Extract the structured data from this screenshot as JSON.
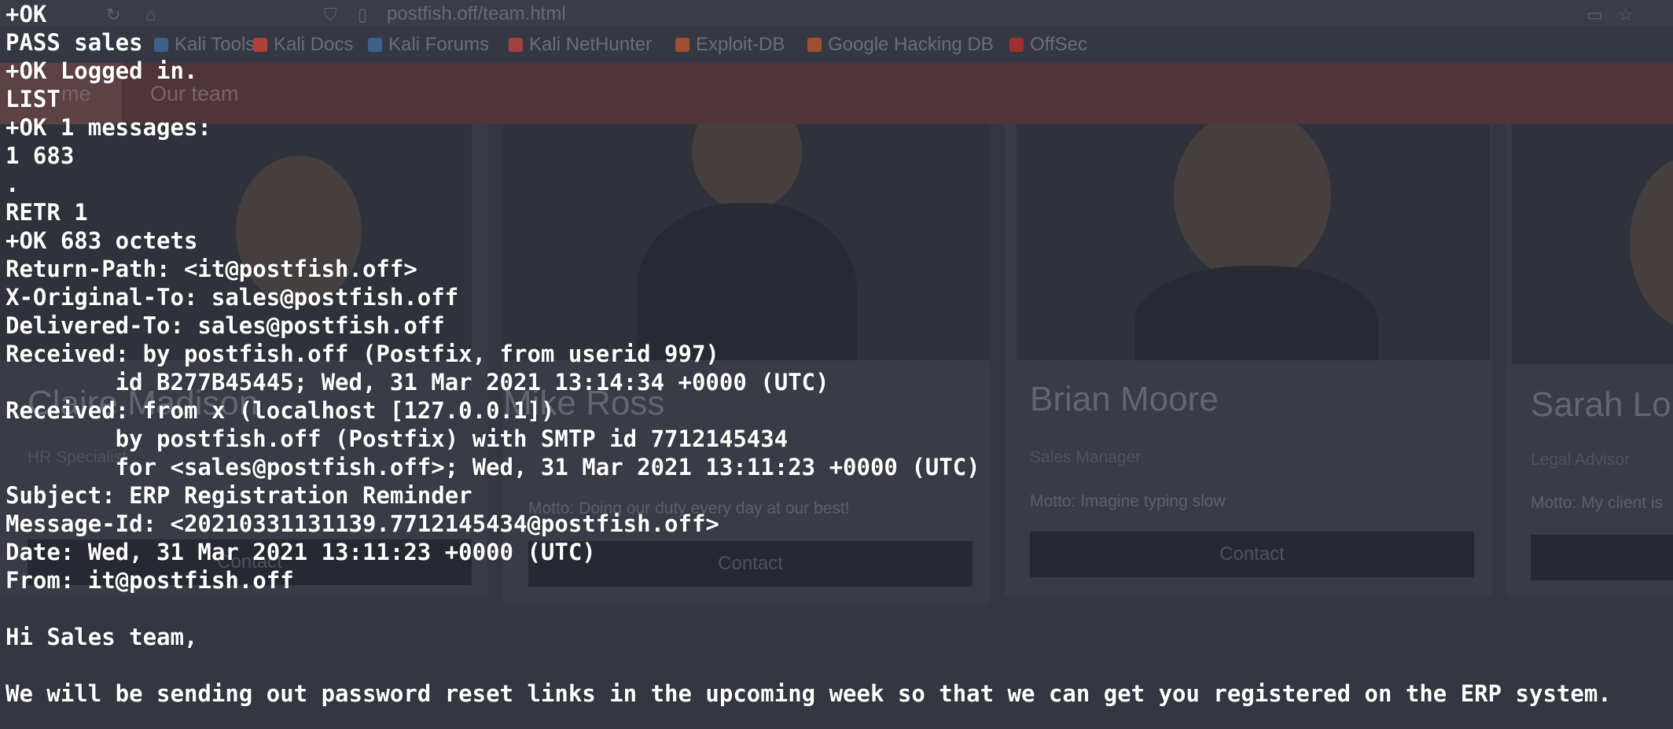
{
  "browser": {
    "url": "postfish.off/team.html",
    "bookmarks": [
      {
        "label": "Kali Tools",
        "color": "#3e5f8a"
      },
      {
        "label": "Kali Docs",
        "color": "#b0403a"
      },
      {
        "label": "Kali Forums",
        "color": "#3e5f8a"
      },
      {
        "label": "Kali NetHunter",
        "color": "#a04040"
      },
      {
        "label": "Exploit-DB",
        "color": "#a05030"
      },
      {
        "label": "Google Hacking DB",
        "color": "#a05030"
      },
      {
        "label": "OffSec",
        "color": "#a03030"
      }
    ],
    "nav": {
      "home": "me",
      "our_team": "Our team"
    }
  },
  "team": [
    {
      "name": "Claire Madison",
      "role": "HR Specialist",
      "motto": "",
      "contact": "Contact"
    },
    {
      "name": "Mike Ross",
      "role": "",
      "motto": "Motto: Doing our duty every day at our best!",
      "contact": "Contact"
    },
    {
      "name": "Brian Moore",
      "role": "Sales Manager",
      "motto": "Motto: Imagine typing slow",
      "contact": "Contact"
    },
    {
      "name": "Sarah Lon",
      "role": "Legal Advisor",
      "motto": "Motto: My client is",
      "contact": ""
    }
  ],
  "terminal": {
    "lines": [
      "+OK",
      "PASS sales",
      "+OK Logged in.",
      "LIST",
      "+OK 1 messages:",
      "1 683",
      ".",
      "RETR 1",
      "+OK 683 octets",
      "Return-Path: <it@postfish.off>",
      "X-Original-To: sales@postfish.off",
      "Delivered-To: sales@postfish.off",
      "Received: by postfish.off (Postfix, from userid 997)",
      "        id B277B45445; Wed, 31 Mar 2021 13:14:34 +0000 (UTC)",
      "Received: from x (localhost [127.0.0.1])",
      "        by postfish.off (Postfix) with SMTP id 7712145434",
      "        for <sales@postfish.off>; Wed, 31 Mar 2021 13:11:23 +0000 (UTC)",
      "Subject: ERP Registration Reminder",
      "Message-Id: <20210331131139.7712145434@postfish.off>",
      "Date: Wed, 31 Mar 2021 13:11:23 +0000 (UTC)",
      "From: it@postfish.off",
      "",
      "Hi Sales team,",
      "",
      "We will be sending out password reset links in the upcoming week so that we can get you registered on the ERP system."
    ]
  }
}
